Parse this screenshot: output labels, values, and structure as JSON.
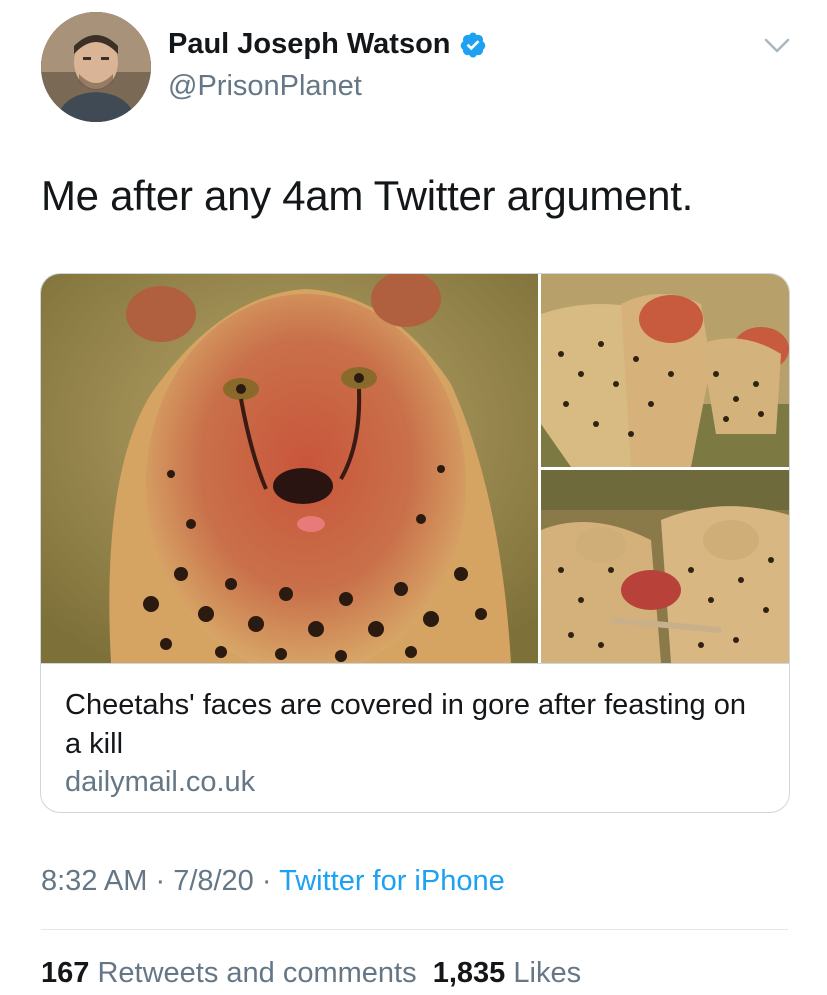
{
  "author": {
    "name": "Paul Joseph Watson",
    "handle": "@PrisonPlanet",
    "verified": true,
    "avatar_icon": "avatar-photo"
  },
  "tweet": {
    "text": "Me after any 4am Twitter argument."
  },
  "card": {
    "title": "Cheetahs' faces are covered in gore after feasting on a kill",
    "domain": "dailymail.co.uk",
    "images": [
      "cheetah-closeup-photo",
      "two-cheetahs-photo",
      "cheetahs-feeding-photo"
    ]
  },
  "meta": {
    "time": "8:32 AM",
    "sep1": " · ",
    "date": "7/8/20",
    "sep2": " · ",
    "source": "Twitter for iPhone"
  },
  "stats": {
    "retweets_count": "167",
    "retweets_label": "Retweets and comments",
    "likes_count": "1,835",
    "likes_label": "Likes"
  },
  "colors": {
    "verified": "#1da1f2",
    "link": "#1da1f2",
    "secondary_text": "#657786",
    "primary_text": "#14171a",
    "border": "#ccd6dd"
  }
}
